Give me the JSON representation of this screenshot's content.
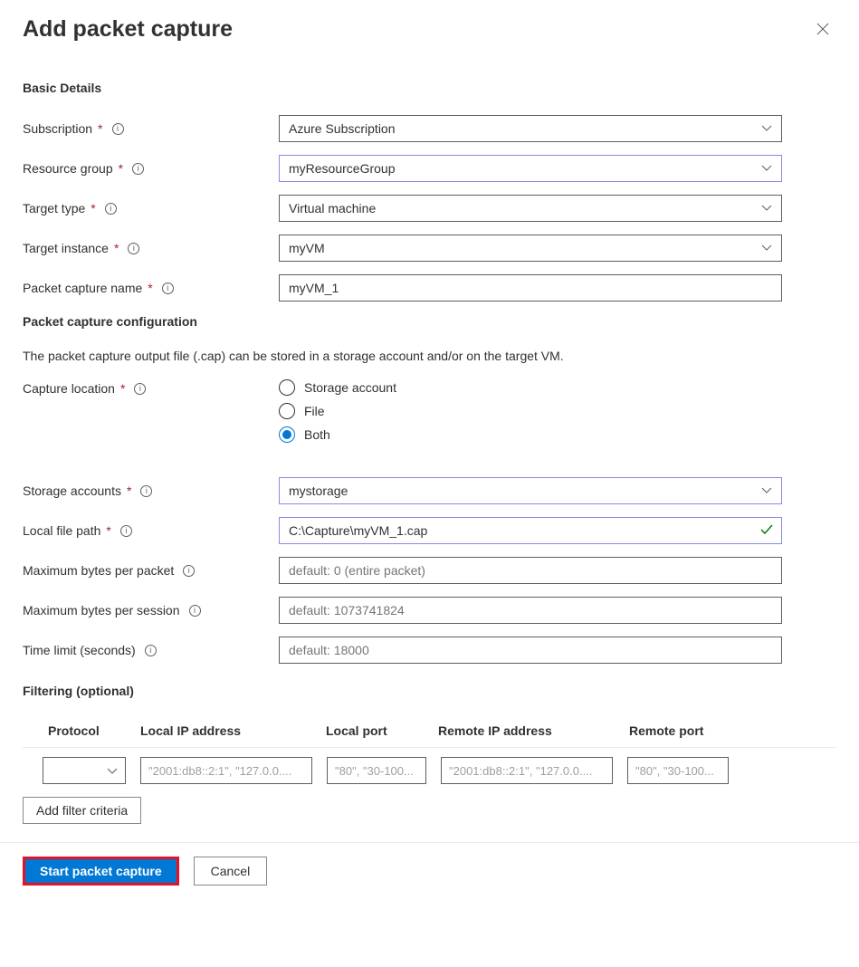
{
  "header": {
    "title": "Add packet capture"
  },
  "sections": {
    "basic": "Basic Details",
    "config": "Packet capture configuration",
    "filter": "Filtering (optional)"
  },
  "labels": {
    "subscription": "Subscription",
    "resource_group": "Resource group",
    "target_type": "Target type",
    "target_instance": "Target instance",
    "capture_name": "Packet capture name",
    "capture_location": "Capture location",
    "storage_accounts": "Storage accounts",
    "local_file_path": "Local file path",
    "max_bytes_packet": "Maximum bytes per packet",
    "max_bytes_session": "Maximum bytes per session",
    "time_limit": "Time limit (seconds)"
  },
  "values": {
    "subscription": "Azure Subscription",
    "resource_group": "myResourceGroup",
    "target_type": "Virtual machine",
    "target_instance": "myVM",
    "capture_name": "myVM_1",
    "storage_accounts": "mystorage",
    "local_file_path": "C:\\Capture\\myVM_1.cap"
  },
  "placeholders": {
    "max_bytes_packet": "default: 0 (entire packet)",
    "max_bytes_session": "default: 1073741824",
    "time_limit": "default: 18000"
  },
  "config_desc": "The packet capture output file (.cap) can be stored in a storage account and/or on the target VM.",
  "capture_location_options": {
    "storage": "Storage account",
    "file": "File",
    "both": "Both"
  },
  "filter": {
    "headers": {
      "protocol": "Protocol",
      "local_ip": "Local IP address",
      "local_port": "Local port",
      "remote_ip": "Remote IP address",
      "remote_port": "Remote port"
    },
    "row_placeholders": {
      "local_ip": "\"2001:db8::2:1\", \"127.0.0....",
      "local_port": "\"80\", \"30-100...",
      "remote_ip": "\"2001:db8::2:1\", \"127.0.0....",
      "remote_port": "\"80\", \"30-100..."
    },
    "add_button": "Add filter criteria"
  },
  "footer": {
    "primary": "Start packet capture",
    "secondary": "Cancel"
  }
}
